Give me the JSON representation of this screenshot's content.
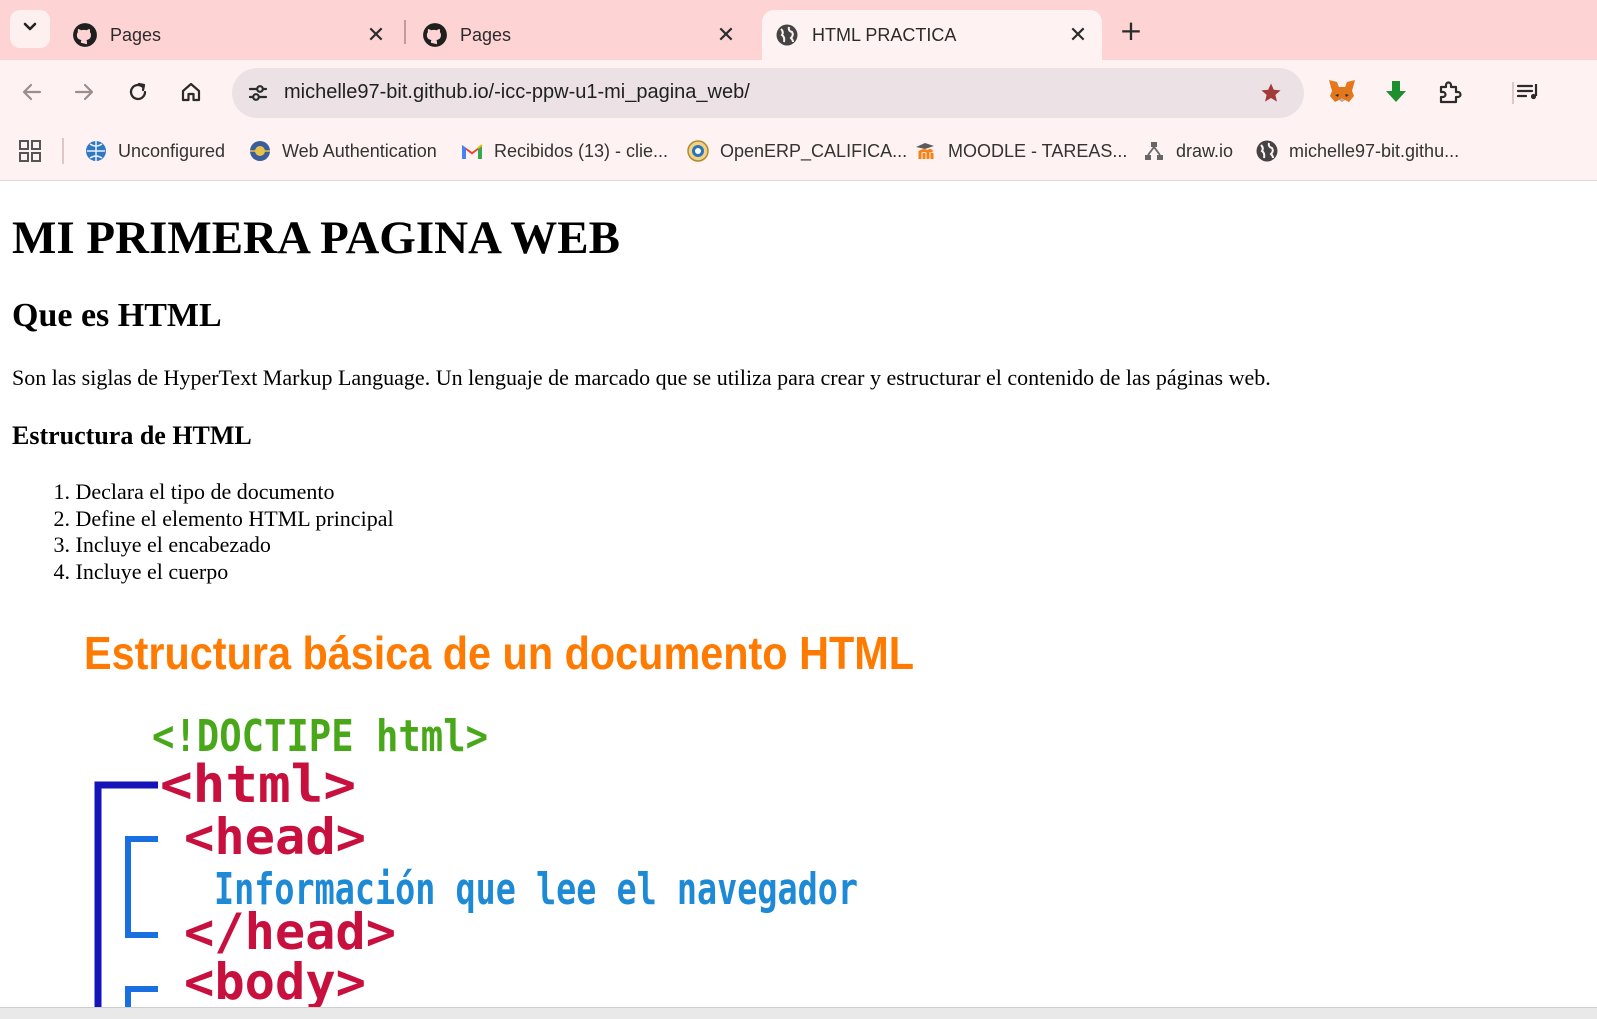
{
  "browser": {
    "tabs": [
      {
        "title": "Pages",
        "favicon": "github-icon",
        "active": false
      },
      {
        "title": "Pages",
        "favicon": "github-icon",
        "active": false
      },
      {
        "title": "HTML PRACTICA",
        "favicon": "globe-icon",
        "active": true
      }
    ],
    "url": "michelle97-bit.github.io/-icc-ppw-u1-mi_pagina_web/",
    "bookmarks": [
      {
        "label": "Unconfigured",
        "icon": "globe-icon"
      },
      {
        "label": "Web Authentication",
        "icon": "seal-icon"
      },
      {
        "label": "Recibidos (13) - clie...",
        "icon": "gmail-icon"
      },
      {
        "label": "OpenERP_CALIFICA...",
        "icon": "emblem-icon"
      },
      {
        "label": "MOODLE - TAREAS...",
        "icon": "moodle-icon"
      },
      {
        "label": "draw.io",
        "icon": "drawio-icon"
      },
      {
        "label": "michelle97-bit.githu...",
        "icon": "globe-icon"
      }
    ],
    "colors": {
      "tab_strip": "#fdd3d3",
      "toolbar": "#fff2f2",
      "omnibox": "#ece2e5",
      "star": "#a33a3a",
      "download": "#1e8f2e"
    }
  },
  "page": {
    "h1": "MI PRIMERA PAGINA WEB",
    "h2": "Que es HTML",
    "paragraph": "Son las siglas de HyperText Markup Language. Un lenguaje de marcado que se utiliza para crear y estructurar el contenido de las páginas web.",
    "h3": "Estructura de HTML",
    "list": [
      {
        "num": "1.",
        "text": "Declara el tipo de documento"
      },
      {
        "num": "2.",
        "text": "Define el elemento HTML principal"
      },
      {
        "num": "3.",
        "text": "Incluye el encabezado"
      },
      {
        "num": "4.",
        "text": "Incluye el cuerpo"
      }
    ],
    "image": {
      "title": "Estructura básica de un documento HTML",
      "doctype": "<!DOCTIPE html>",
      "html_open": "<html>",
      "head_open": "<head>",
      "head_info": "Información que lee el navegador",
      "head_close": "</head>",
      "body_open": "<body>",
      "colors": {
        "title": "#ff7a00",
        "doctype": "#49a81a",
        "tags": "#c8103e",
        "info": "#1e8ad6",
        "bracket_outer": "#1414b8",
        "bracket_inner": "#1a6fe0"
      }
    }
  }
}
